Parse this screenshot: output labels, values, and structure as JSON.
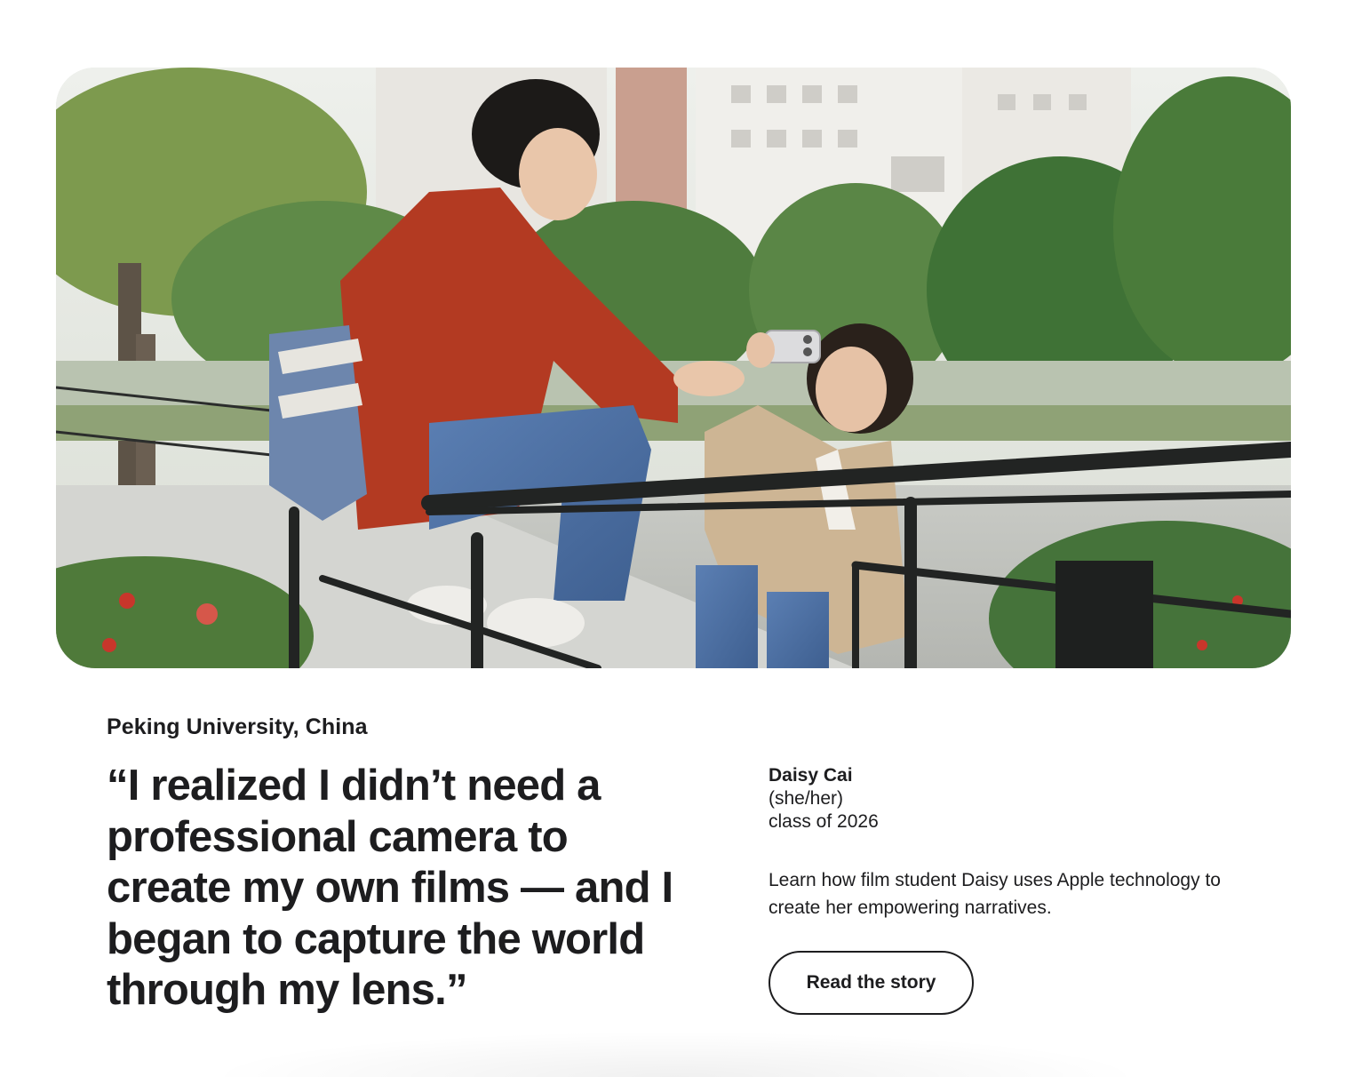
{
  "card": {
    "photo_alt": "Two students by a riverside railing, one filming the other with an iPhone",
    "location": "Peking University, China",
    "quote": "“I realized I didn’t need a professional camera to create my own films — and I began to capture the world through my lens.”",
    "person": {
      "name": "Daisy Cai",
      "pronouns": "(she/her)",
      "class": "class of 2026"
    },
    "description": "Learn how film student Daisy uses Apple technology to create her empowering narratives.",
    "cta_label": "Read the story"
  },
  "colors": {
    "text": "#1d1d1f",
    "background": "#ffffff",
    "button_border": "#1d1d1f"
  }
}
